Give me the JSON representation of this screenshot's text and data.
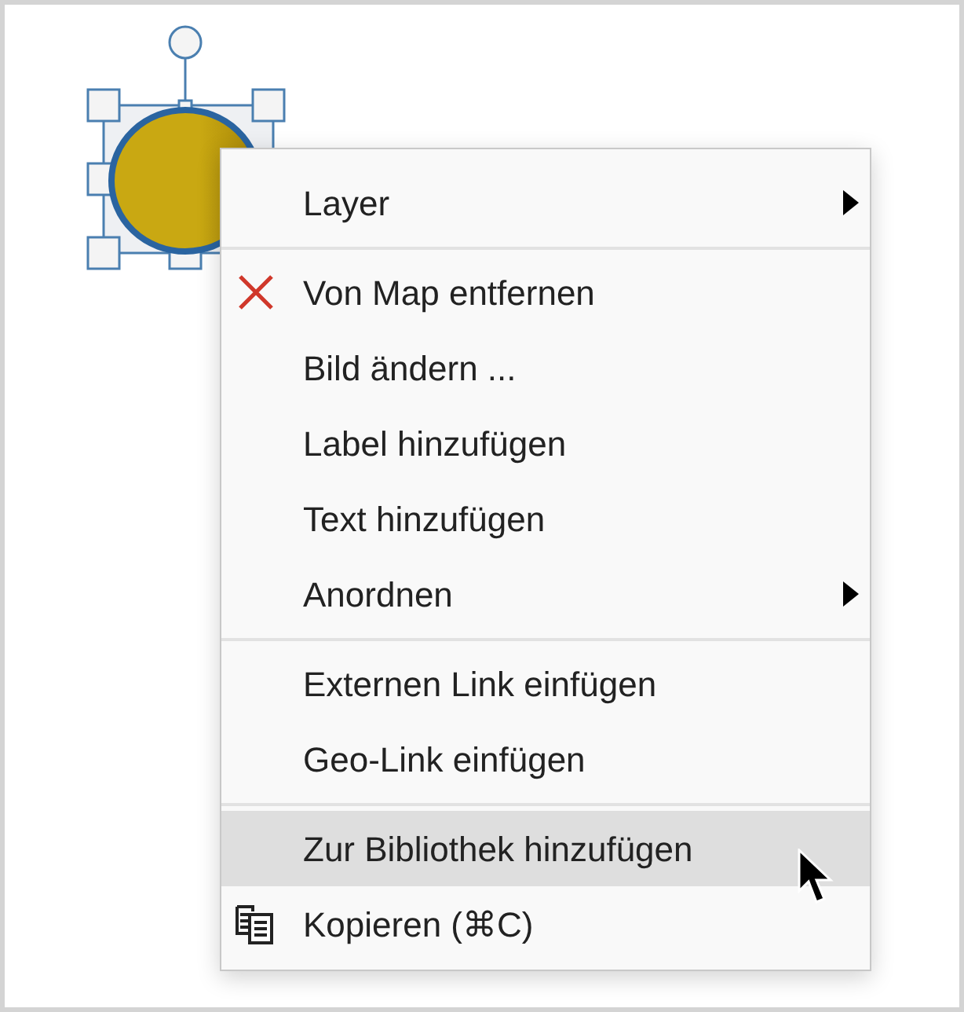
{
  "canvas": {
    "shape": {
      "selected": true
    }
  },
  "context_menu": {
    "items": [
      {
        "kind": "item",
        "label": "Layer",
        "submenu": true,
        "selected": false
      },
      {
        "kind": "separator"
      },
      {
        "kind": "remove",
        "label": "Von Map entfernen",
        "submenu": false,
        "selected": false
      },
      {
        "kind": "item",
        "label": "Bild ändern ...",
        "submenu": false,
        "selected": false
      },
      {
        "kind": "item",
        "label": "Label hinzufügen",
        "submenu": false,
        "selected": false
      },
      {
        "kind": "item",
        "label": "Text hinzufügen",
        "submenu": false,
        "selected": false
      },
      {
        "kind": "item",
        "label": "Anordnen",
        "submenu": true,
        "selected": false
      },
      {
        "kind": "separator"
      },
      {
        "kind": "item",
        "label": "Externen Link einfügen",
        "submenu": false,
        "selected": false
      },
      {
        "kind": "item",
        "label": "Geo-Link einfügen",
        "submenu": false,
        "selected": false
      },
      {
        "kind": "separator"
      },
      {
        "kind": "item",
        "label": "Zur Bibliothek hinzufügen",
        "submenu": false,
        "selected": true
      },
      {
        "kind": "copy",
        "label": "Kopieren (⌘C)",
        "submenu": false,
        "selected": false
      }
    ]
  }
}
